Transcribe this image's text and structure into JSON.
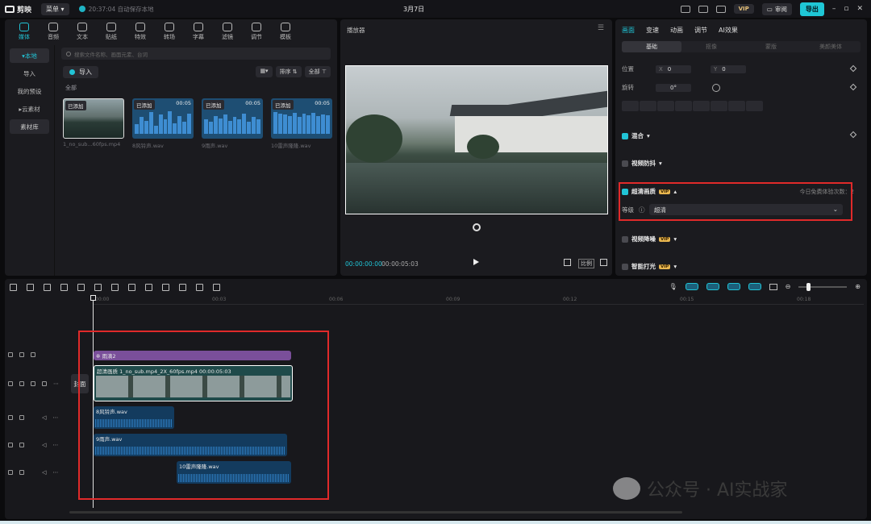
{
  "titlebar": {
    "app_name": "剪映",
    "menu_label": "菜单",
    "save_status": "20:37:04 自动保存本地",
    "project_title": "3月7日",
    "vip_label": "VIP",
    "review_label": "审阅",
    "export_label": "导出"
  },
  "media": {
    "tabs": [
      {
        "label": "媒体"
      },
      {
        "label": "音频"
      },
      {
        "label": "文本"
      },
      {
        "label": "贴纸"
      },
      {
        "label": "特效"
      },
      {
        "label": "转场"
      },
      {
        "label": "字幕"
      },
      {
        "label": "滤镜"
      },
      {
        "label": "调节"
      },
      {
        "label": "模板"
      }
    ],
    "side_items": [
      "本地",
      "导入",
      "我的预设",
      "云素材",
      "素材库"
    ],
    "search_placeholder": "搜索文件名称、画面元素、台词",
    "import_label": "导入",
    "sort_label": "排序",
    "filter_label": "全部",
    "section_label": "全部",
    "items": [
      {
        "badge": "已添加",
        "duration": "",
        "name": "1_no_sub...60fps.mp4",
        "kind": "video"
      },
      {
        "badge": "已添加",
        "duration": "00:05",
        "name": "8风铃声.wav",
        "kind": "audio"
      },
      {
        "badge": "已添加",
        "duration": "00:05",
        "name": "9雨声.wav",
        "kind": "audio"
      },
      {
        "badge": "已添加",
        "duration": "00:05",
        "name": "10雷声隆隆.wav",
        "kind": "audio"
      }
    ]
  },
  "player": {
    "title": "播放器",
    "current_time": "00:00:00:00",
    "total_time": "00:00:05:03",
    "ratio_label": "比例"
  },
  "props": {
    "tabs": [
      "画面",
      "变速",
      "动画",
      "调节",
      "AI效果"
    ],
    "subtabs": [
      "基础",
      "抠像",
      "蒙版",
      "美颜美体"
    ],
    "position_label": "位置",
    "x_label": "X",
    "x_value": "0",
    "y_label": "Y",
    "y_value": "0",
    "rotate_label": "旋转",
    "rotate_value": "0°",
    "blend_label": "混合",
    "stabilize_label": "视频防抖",
    "hd_label": "超清画质",
    "vip_tag": "VIP",
    "free_note": "今日免费体验次数：2",
    "level_label": "等级",
    "level_value": "超清",
    "denoise_label": "视频降噪",
    "lighting_label": "智能打光"
  },
  "timeline": {
    "ruler_ticks": [
      "00:00",
      "00:03",
      "00:06",
      "00:09",
      "00:12",
      "00:15",
      "00:18"
    ],
    "cover_label": "封面",
    "clips": {
      "fx": "雨滴2",
      "video": "超清画质   1_no_sub.mp4_2X_60fps.mp4   00:00:05:03",
      "audio1": "8风铃声.wav",
      "audio2": "9雨声.wav",
      "audio3": "10雷声隆隆.wav"
    }
  },
  "watermark": "公众号 · AI实战家"
}
